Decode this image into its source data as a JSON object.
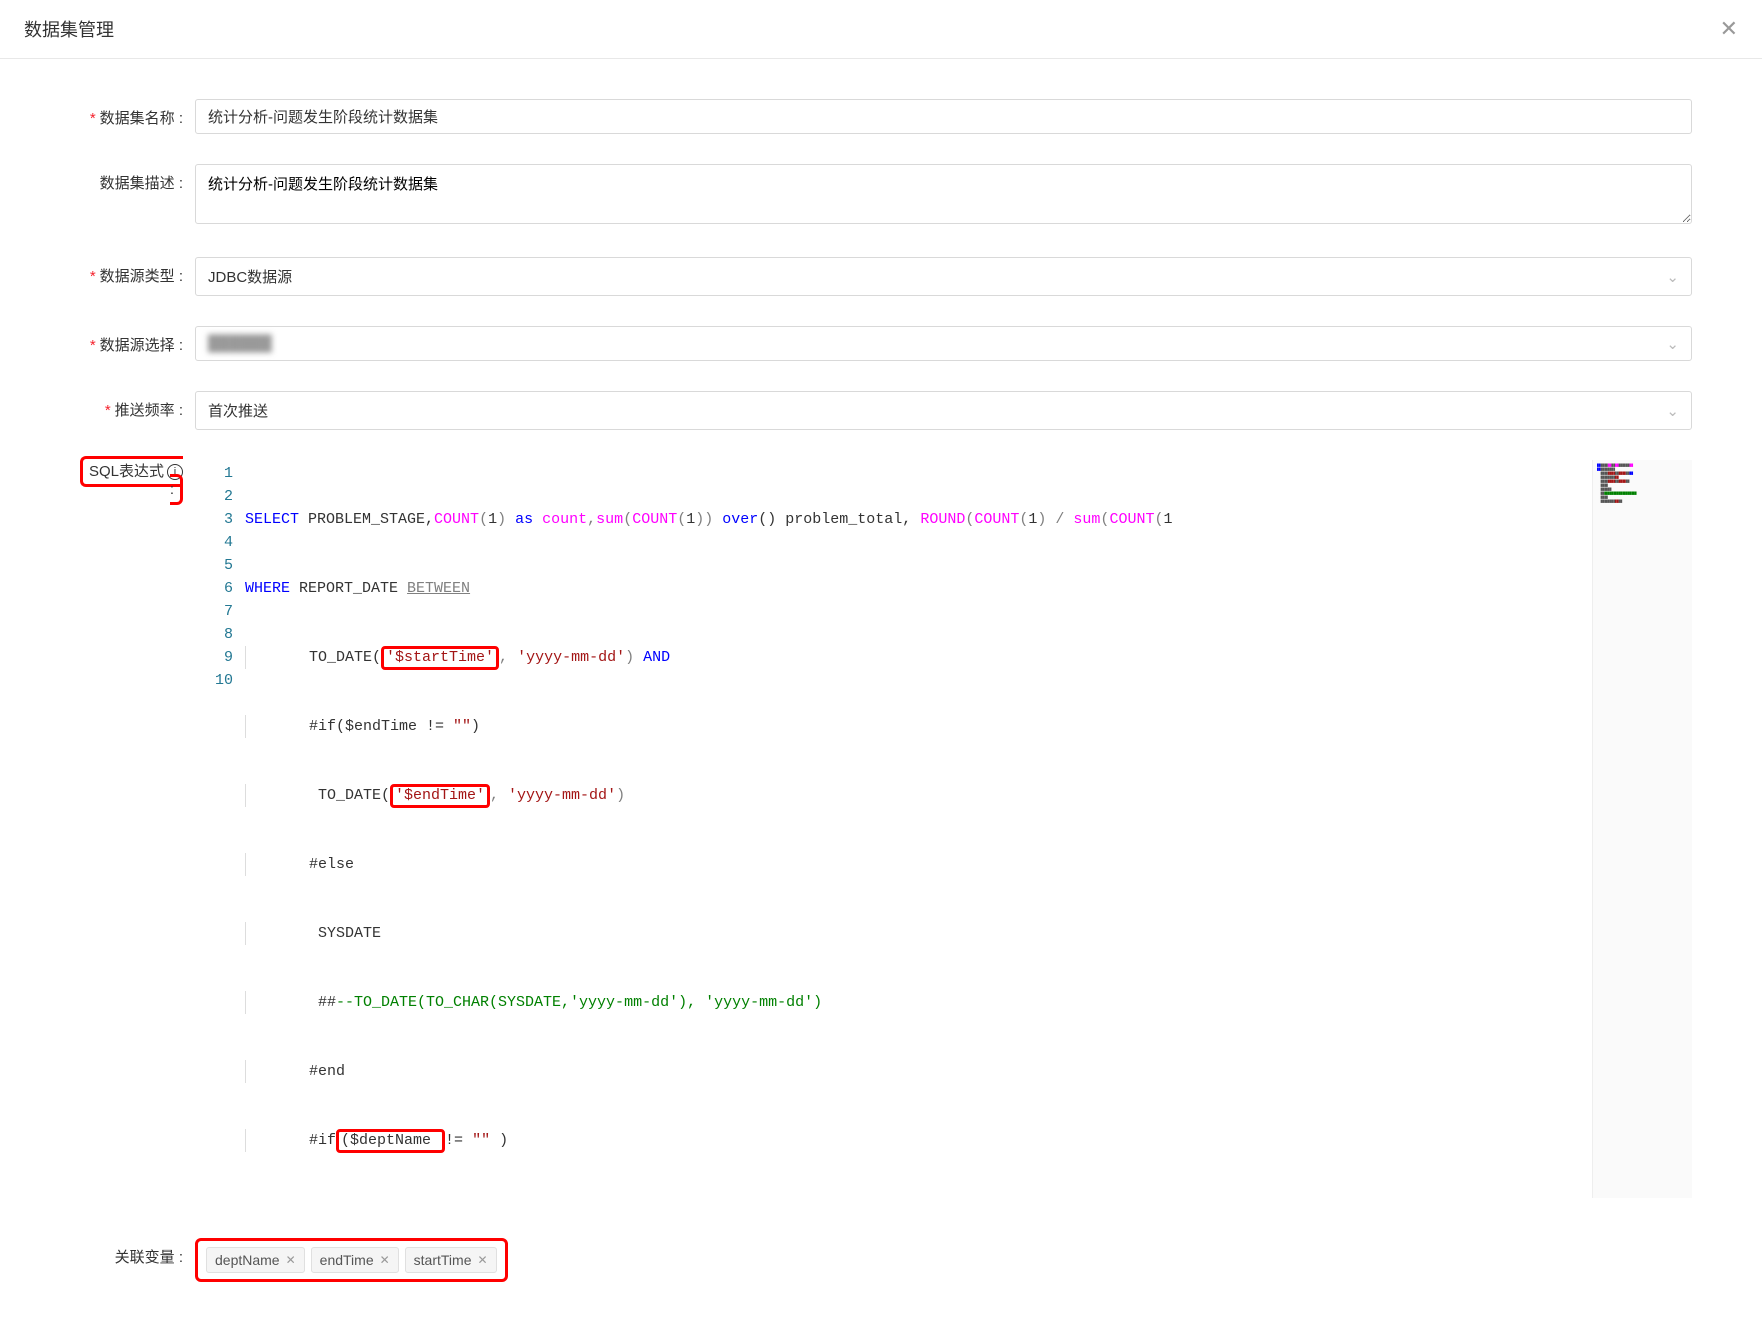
{
  "header": {
    "title": "数据集管理"
  },
  "form": {
    "name": {
      "label": "数据集名称 :",
      "value": "统计分析-问题发生阶段统计数据集"
    },
    "desc": {
      "label": "数据集描述 :",
      "value": "统计分析-问题发生阶段统计数据集"
    },
    "sourceType": {
      "label": "数据源类型 :",
      "value": "JDBC数据源"
    },
    "sourceSelect": {
      "label": "数据源选择 :",
      "value": ""
    },
    "pushFreq": {
      "label": "推送频率 :",
      "value": "首次推送"
    },
    "sqlLabel": "SQL表达式",
    "linkVarLabel": "关联变量 :"
  },
  "sql": {
    "lines": {
      "l1a": "SELECT",
      "l1b": " PROBLEM_STAGE,",
      "l1c": "COUNT",
      "l1d": "(",
      "l1e": "1",
      "l1f": ") ",
      "l1g": "as",
      "l1h": " ",
      "l1i": "count",
      "l1j": ",",
      "l1k": "sum",
      "l1l": "(",
      "l1m": "COUNT",
      "l1n": "(",
      "l1o": "1",
      "l1p": ")) ",
      "l1q": "over",
      "l1r": "() problem_total, ",
      "l1s": "ROUND",
      "l1t": "(",
      "l1u": "COUNT",
      "l1v": "(",
      "l1w": "1",
      "l1x": ") / ",
      "l1y": "sum",
      "l1z": "(",
      "l1aa": "COUNT",
      "l1ab": "(",
      "l1ac": "1",
      "l2a": "WHERE",
      "l2b": " REPORT_DATE ",
      "l2c": "BETWEEN",
      "l3a": "TO_DATE(",
      "l3b": "'$startTime'",
      "l3c": ", ",
      "l3d": "'yyyy-mm-dd'",
      "l3e": ") ",
      "l3f": "AND",
      "l4a": "#if($endTime != ",
      "l4b": "\"\"",
      "l4c": ")",
      "l5a": " TO_DATE(",
      "l5b": "'$endTime'",
      "l5c": ", ",
      "l5d": "'yyyy-mm-dd'",
      "l5e": ")",
      "l6a": "#else",
      "l7a": " SYSDATE",
      "l8a": " ##",
      "l8b": "--TO_DATE(TO_CHAR(SYSDATE,'yyyy-mm-dd'), 'yyyy-mm-dd')",
      "l9a": "#end",
      "l10a": "#if",
      "l10b": "($deptName ",
      "l10c": "!= ",
      "l10d": "\"\"",
      "l10e": " )"
    },
    "lineNumbers": [
      "1",
      "2",
      "3",
      "4",
      "5",
      "6",
      "7",
      "8",
      "9",
      "10"
    ]
  },
  "tags": [
    {
      "name": "deptName"
    },
    {
      "name": "endTime"
    },
    {
      "name": "startTime"
    }
  ]
}
